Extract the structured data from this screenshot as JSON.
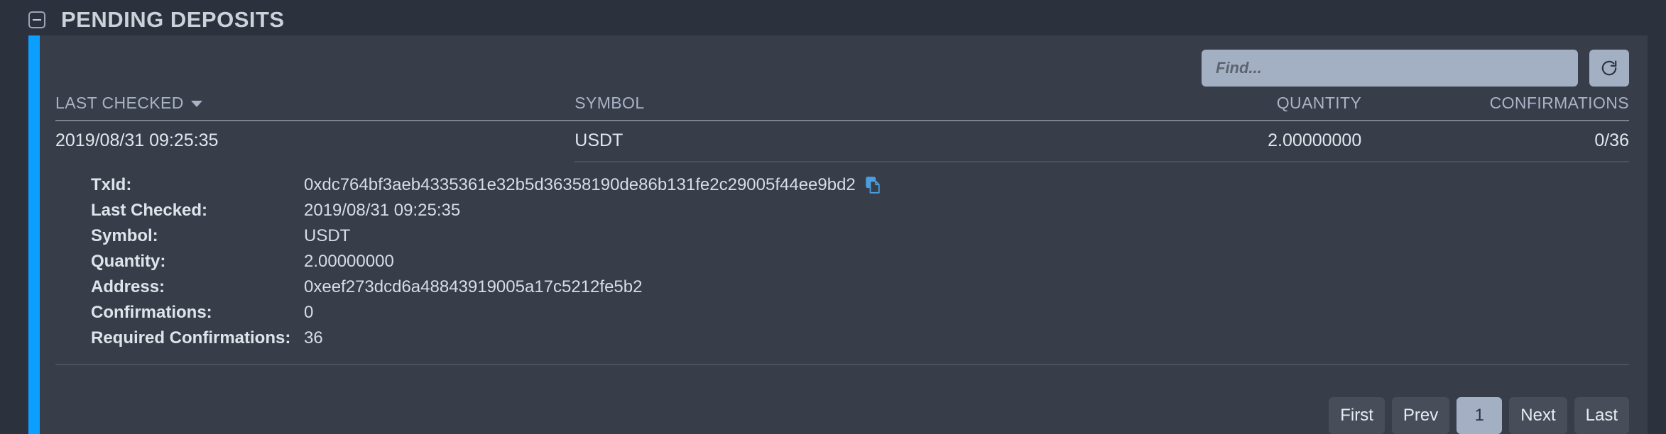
{
  "panel": {
    "title": "PENDING DEPOSITS",
    "collapse_icon": "collapse-minus-icon",
    "accent_color": "#0d9fff"
  },
  "toolbar": {
    "find_placeholder": "Find...",
    "find_value": "",
    "refresh_icon": "refresh-icon"
  },
  "table": {
    "columns": [
      {
        "label": "LAST CHECKED",
        "sorted": "desc"
      },
      {
        "label": "SYMBOL",
        "sorted": ""
      },
      {
        "label": "QUANTITY",
        "sorted": ""
      },
      {
        "label": "CONFIRMATIONS",
        "sorted": ""
      }
    ],
    "rows": [
      {
        "last_checked": "2019/08/31 09:25:35",
        "symbol": "USDT",
        "quantity": "2.00000000",
        "confirmations": "0/36"
      }
    ]
  },
  "detail": {
    "labels": {
      "txid": "TxId:",
      "last_checked": "Last Checked:",
      "symbol": "Symbol:",
      "quantity": "Quantity:",
      "address": "Address:",
      "confirmations": "Confirmations:",
      "required_confirmations": "Required Confirmations:"
    },
    "values": {
      "txid": "0xdc764bf3aeb4335361e32b5d36358190de86b131fe2c29005f44ee9bd2",
      "last_checked": "2019/08/31 09:25:35",
      "symbol": "USDT",
      "quantity": "2.00000000",
      "address": "0xeef273dcd6a48843919005a17c5212fe5b2",
      "confirmations": "0",
      "required_confirmations": "36"
    },
    "copy_icon": "copy-icon",
    "copy_icon_color": "#4a9fe0"
  },
  "pagination": {
    "first": "First",
    "prev": "Prev",
    "current": "1",
    "next": "Next",
    "last": "Last"
  }
}
